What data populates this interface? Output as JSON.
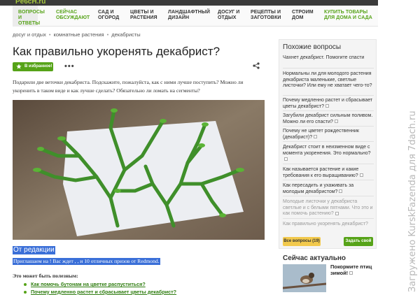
{
  "site": {
    "logo_text": "Pe6cH.ru"
  },
  "nav": {
    "items": [
      {
        "label": "ВОПРОСЫ И ОТВЕТЫ"
      },
      {
        "label": "СЕЙЧАС ОБСУЖДАЮТ"
      },
      {
        "label": "САД И ОГОРОД"
      },
      {
        "label": "ЦВЕТЫ И РАСТЕНИЯ"
      },
      {
        "label": "ЛАНДШАФТНЫЙ ДИЗАЙН"
      },
      {
        "label": "ДОСУГ И ОТДЫХ"
      },
      {
        "label": "РЕЦЕПТЫ И ЗАГОТОВКИ"
      },
      {
        "label": "СТРОИМ ДОМ"
      },
      {
        "label": "КУПИТЬ ТОВАРЫ ДЛЯ ДОМА И САДА"
      }
    ]
  },
  "breadcrumbs": [
    "досуг и отдых",
    "комнатные растения",
    "декабристы"
  ],
  "page": {
    "title": "Как правильно укоренять декабрист?",
    "favorite_label": "В избранное!",
    "more_label": "•••",
    "question_text": "Подарили две веточки декабриста. Подскажите, пожалуйста, как с ними лучше поступить? Можно ли укоренить в таком виде и как лучше сделать? Обязательно ли ломать на сегменты?"
  },
  "editorial": {
    "title": "От редакции",
    "text": "Приглашаем на ! Вас ждет , , и 10 отличных призов от Redmond.",
    "useful_label": "Это может быть полезным:",
    "links": [
      "Как помочь бутонам на цветке распуститься?",
      "Почему медленно растет и сбрасывает цветы декабрист?"
    ]
  },
  "sidebar": {
    "title": "Похожие вопросы",
    "items": [
      "Чахнет декабрист. Помогите спасти",
      "Нормальны ли для молодого растения декабриста маленькие, светлые листочки? Или ему не хватает чего-то?",
      "Почему медленно растет и сбрасывает цветы декабрист?",
      "Загубили декабрист сильным поливом. Можно ли его спасти?",
      "Почему не цветет рождественник (декабрист)?",
      "Декабрист стоит в неизменном виде с момента укоренения. Это нормально?",
      "Как называется растение и какие требования к его выращиванию?",
      "Как пересадить и ухаживать за молодым декабристом?",
      "Молодые листочки у декабриста светлые и с белыми пятнами. Что это и как помочь растению?",
      "Как правильно укоренять декабрист?"
    ],
    "all_questions_label": "Все вопросы (19)",
    "ask_label": "Задать свой"
  },
  "now_actual": {
    "title": "Сейчас актуально",
    "item_text": "Покормите птиц зимой!"
  },
  "watermark": "Загружено KurskFazenda для 7dach.ru",
  "colors": {
    "accent_green": "#56a318",
    "highlight_blue": "#3a6fd8",
    "button_yellow": "#f2c94c"
  }
}
